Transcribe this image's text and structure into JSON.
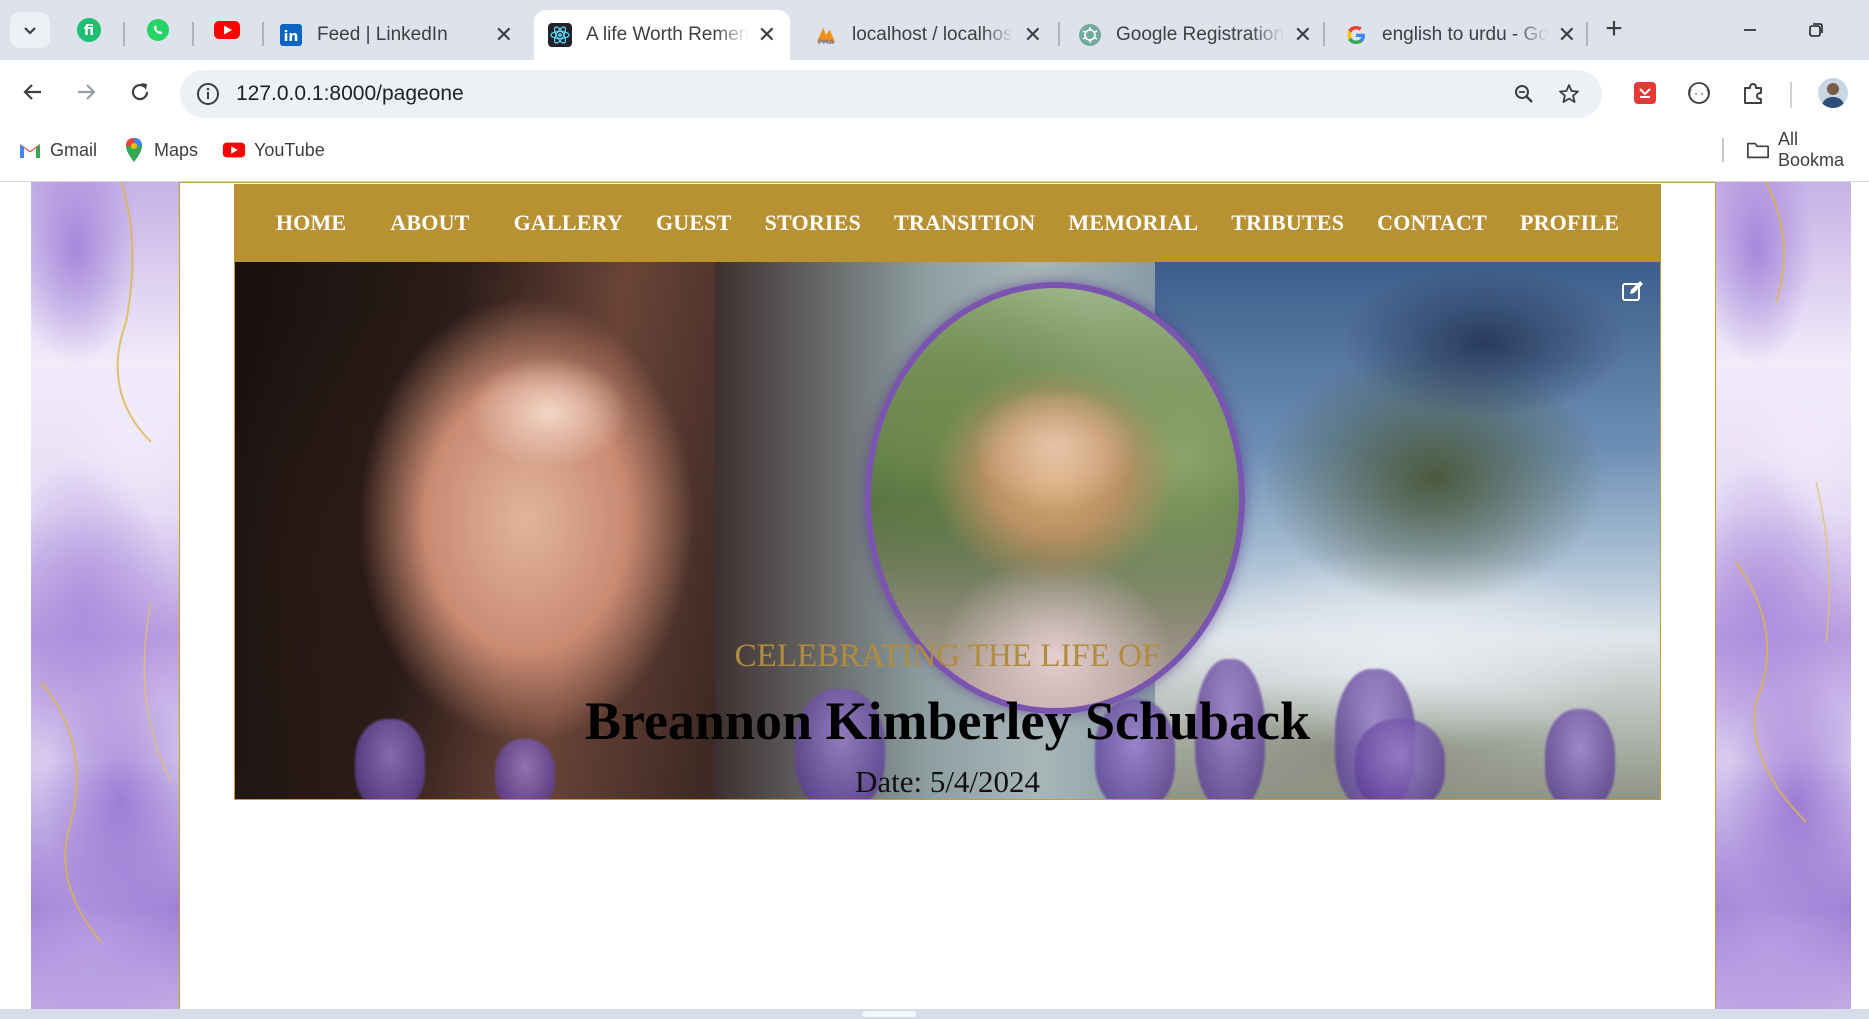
{
  "browser": {
    "tabs": [
      {
        "title": "Feed | LinkedIn",
        "icon": "linkedin-icon",
        "active": false
      },
      {
        "title": "A life Worth Remem",
        "icon": "react-icon",
        "active": true
      },
      {
        "title": "localhost / localhost",
        "icon": "phpmyadmin-icon",
        "active": false
      },
      {
        "title": "Google Registration",
        "icon": "chatgpt-icon",
        "active": false
      },
      {
        "title": "english to urdu - Go",
        "icon": "google-icon",
        "active": false
      }
    ],
    "pinned_tabs": [
      "fiverr-icon",
      "whatsapp-icon",
      "youtube-icon"
    ],
    "url": "127.0.0.1:8000/pageone",
    "bookmarks": [
      {
        "label": "Gmail",
        "icon": "gmail-icon"
      },
      {
        "label": "Maps",
        "icon": "maps-icon"
      },
      {
        "label": "YouTube",
        "icon": "youtube-icon"
      }
    ],
    "all_bookmarks": "All Bookma"
  },
  "site": {
    "nav": [
      "HOME",
      "ABOUT",
      "GALLERY",
      "GUEST",
      "STORIES",
      "TRANSITION",
      "MEMORIAL",
      "TRIBUTES",
      "CONTACT",
      "PROFILE"
    ],
    "heading": "CELEBRATING THE LIFE OF",
    "name": "Breannon Kimberley Schuback",
    "date": "Date: 5/4/2024"
  },
  "colors": {
    "nav_bg": "#b89133",
    "heading_gold": "#b18c3f",
    "oval_border": "#7a55b0"
  }
}
